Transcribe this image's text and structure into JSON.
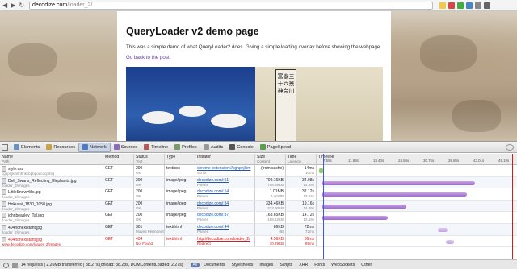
{
  "browser": {
    "url_host": "decodize.com",
    "url_path": "/loader_2/",
    "nav": [
      "◀",
      "▶",
      "↻"
    ]
  },
  "page": {
    "title": "QueryLoader v2 demo page",
    "description": "This was a simple demo of what QueryLoader2 does. Giving a simple loading overlay before showing the webpage.",
    "back_link": "Go back to the post",
    "sign_text": "富嶽三十六景 神奈川"
  },
  "devtools": {
    "tabs": [
      {
        "label": "Elements",
        "icon": "elements-icon",
        "color": "#6b8fbf"
      },
      {
        "label": "Resources",
        "icon": "resources-icon",
        "color": "#c9a24b"
      },
      {
        "label": "Network",
        "icon": "network-icon",
        "color": "#4a7bc4"
      },
      {
        "label": "Sources",
        "icon": "sources-icon",
        "color": "#8a6bbf"
      },
      {
        "label": "Timeline",
        "icon": "timeline-icon",
        "color": "#b05a5a"
      },
      {
        "label": "Profiles",
        "icon": "profiles-icon",
        "color": "#7a9a6a"
      },
      {
        "label": "Audits",
        "icon": "audits-icon",
        "color": "#999999"
      },
      {
        "label": "Console",
        "icon": "console-icon",
        "color": "#555555"
      },
      {
        "label": "PageSpeed",
        "icon": "pagespeed-icon",
        "color": "#5aa04a"
      }
    ],
    "active_tab": 2,
    "columns": {
      "name": "Name",
      "name_sub": "Path",
      "method": "Method",
      "status": "Status",
      "status_sub": "Text",
      "type": "Type",
      "initiator": "Initiator",
      "size": "Size",
      "size_sub": "Content",
      "time": "Time",
      "time_sub": "Latency",
      "timeline": "Timeline"
    },
    "ticks": [
      "7.69s",
      "11.83s",
      "18.40s",
      "24.58s",
      "30.75s",
      "36.85s",
      "43.01s",
      "49.19s"
    ],
    "rows": [
      {
        "name": "style.css",
        "path": "cgnpnjkimlnhnkcbpbpodcocpmig",
        "method": "GET",
        "status": "200",
        "status_text": "OK",
        "type": "text/css",
        "initiator": "chrome-extension://cgnpnjkim",
        "initiator_sub": "Script",
        "size": "(from cache)",
        "size_sub": "",
        "time": "14ms",
        "latency": "10ms",
        "err": false
      },
      {
        "name": "Deli_Swans_Reflecting_Elephants.jpg",
        "path": "/loader_2/images",
        "method": "GET",
        "status": "200",
        "status_text": "OK",
        "type": "image/jpeg",
        "initiator": "decodize.com/:51",
        "initiator_sub": "Parser",
        "size": "709.16KB",
        "size_sub": "708.89KB",
        "time": "34.08s",
        "latency": "14.99s",
        "err": false
      },
      {
        "name": "LittleSnowHills.jpg",
        "path": "/loader_2/images",
        "method": "GET",
        "status": "200",
        "status_text": "OK",
        "type": "image/jpeg",
        "initiator": "decodize.com/:14",
        "initiator_sub": "Parser",
        "size": "1.01MB",
        "size_sub": "1.01MB",
        "time": "32.12s",
        "latency": "13.04s",
        "err": false
      },
      {
        "name": "Hokusai_1830_1050.jpg",
        "path": "/loader_2/images",
        "method": "GET",
        "status": "200",
        "status_text": "OK",
        "type": "image/jpeg",
        "initiator": "decodize.com/:34",
        "initiator_sub": "Parser",
        "size": "334.46KB",
        "size_sub": "333.90KB",
        "time": "19.16s",
        "latency": "14.39s",
        "err": false
      },
      {
        "name": "johnbeasley_Tal.jpg",
        "path": "/loader_2/images",
        "method": "GET",
        "status": "200",
        "status_text": "OK",
        "type": "image/jpeg",
        "initiator": "decodize.com/:37",
        "initiator_sub": "Parser",
        "size": "168.65KB",
        "size_sub": "168.22KB",
        "time": "14.72s",
        "latency": "12.69s",
        "err": false
      },
      {
        "name": "404nonexistant.jpg",
        "path": "/loader_2/images",
        "method": "GET",
        "status": "301",
        "status_text": "Moved Permanent",
        "type": "text/html",
        "initiator": "decodize.com/:44",
        "initiator_sub": "Parser",
        "size": "86KB",
        "size_sub": "0B",
        "time": "72ms",
        "latency": "72ms",
        "err": false
      },
      {
        "name": "404nonexistant.jpg",
        "path": "www.decodize.com/loader_2/images",
        "method": "GET",
        "status": "404",
        "status_text": "Not Found",
        "type": "text/html",
        "initiator": "http://decodize.com/loader_2/",
        "initiator_sub": "Redirect",
        "size": "4.56KB",
        "size_sub": "10.29KB",
        "time": "86ms",
        "latency": "85ms",
        "err": true
      }
    ],
    "summary": {
      "stats": "14 requests  |  2.26MB transferred  |  38.27s (onload: 38.28s, DOMContentLoaded: 2.27s)",
      "filters": [
        "All",
        "Documents",
        "Stylesheets",
        "Images",
        "Scripts",
        "XHR",
        "Fonts",
        "WebSockets",
        "Other"
      ],
      "active_filter": 0
    }
  }
}
